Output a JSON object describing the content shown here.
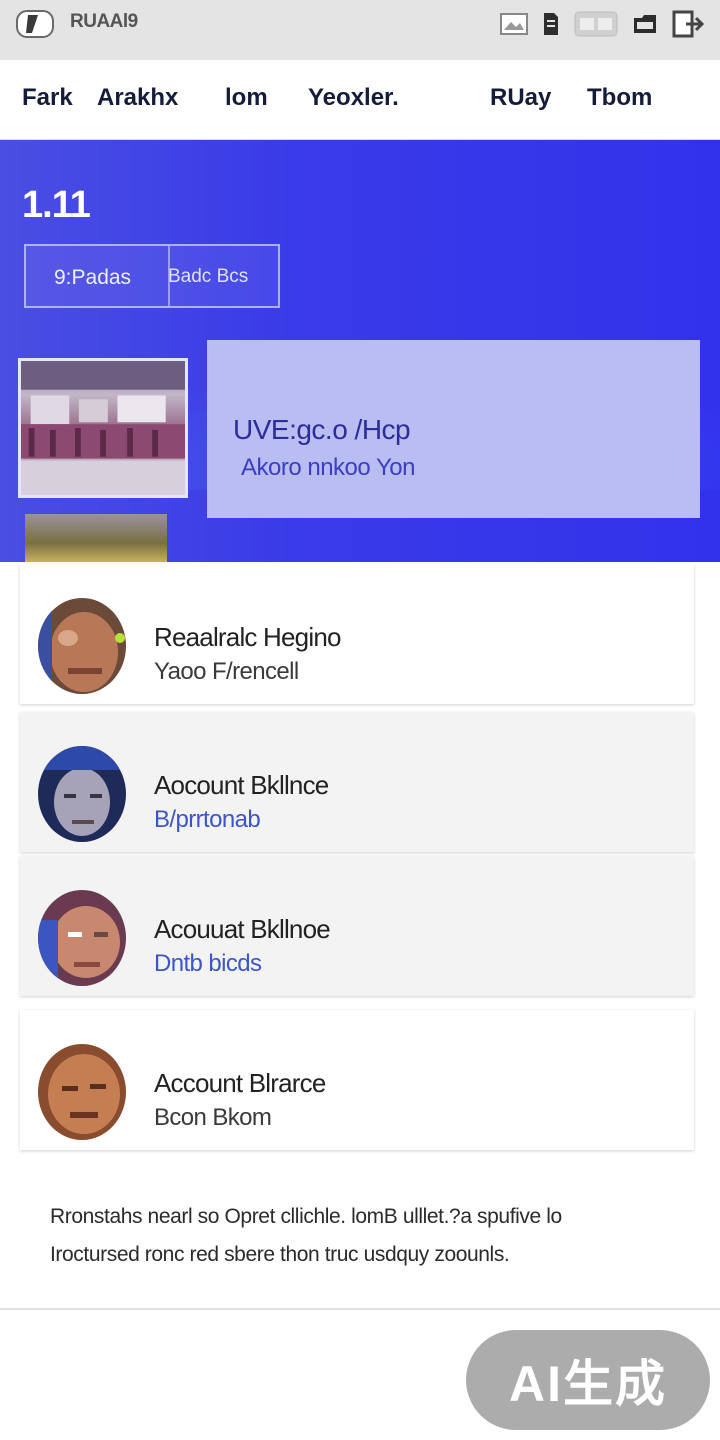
{
  "status_bar": {
    "title": "RUAAl9",
    "logo_icon": "app-logo-icon",
    "icons": [
      "image-icon",
      "document-icon",
      "toggle-icon",
      "folder-icon",
      "exit-icon"
    ]
  },
  "nav": {
    "items": [
      {
        "label": "Fark"
      },
      {
        "label": "Arakhx"
      },
      {
        "label": "lom"
      },
      {
        "label": "Yeoxler."
      },
      {
        "label": "RUay"
      },
      {
        "label": "Tbom"
      }
    ]
  },
  "hero": {
    "value": "1.11",
    "pill_left": "9:Padas",
    "pill_right": "Badc Bcs",
    "card_title": "UVE:gc.o /Hcp",
    "card_subtitle": "Akoro nnkoo Yon"
  },
  "list": {
    "items": [
      {
        "title": "Reaalralc Hegino",
        "subtitle": "Yaoo F/rencell"
      },
      {
        "title": "Aocount Bkllnce",
        "subtitle": "B/prrtonab"
      },
      {
        "title": "Acouuat Bkllnoe",
        "subtitle": "Dntb bicds"
      },
      {
        "title": "Account Blrarce",
        "subtitle": "Bcon Bkom"
      }
    ]
  },
  "footer": {
    "line1": "Rronstahs nearl so Opret cllichle. lomB ulllet.?a spufive lo",
    "line2": "Iroctursed ronc red sbere thon truc usdquy zoounls."
  },
  "badge": {
    "label": "AI生成"
  },
  "colors": {
    "hero_blue": "#3232ec",
    "hero_card": "#b9bdf2",
    "nav_text": "#141c3a",
    "accent_text": "#3d55c8",
    "badge_bg": "#8c8c8c"
  }
}
